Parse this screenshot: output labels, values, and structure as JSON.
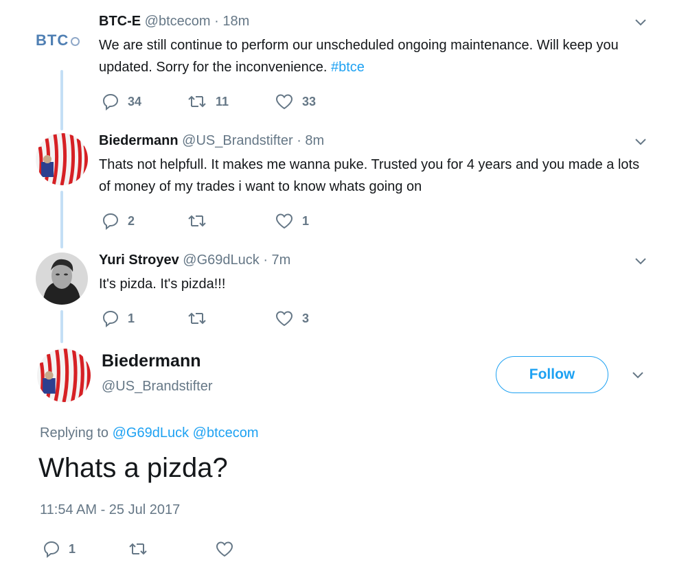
{
  "tweets": [
    {
      "name": "BTC-E",
      "handle": "@btcecom",
      "time": "· 18m",
      "avatar_text": "BTC",
      "text": "We are still continue to perform our unscheduled ongoing maintenance.  Will keep you updated. Sorry for the inconvenience.",
      "hashtag": "#btce",
      "replies": "34",
      "retweets": "11",
      "likes": "33"
    },
    {
      "name": "Biedermann",
      "handle": "@US_Brandstifter",
      "time": "· 8m",
      "text": "Thats not helpfull. It makes me wanna puke. Trusted you for 4 years and you made a lots of money of my trades i want to know whats going on",
      "replies": "2",
      "retweets": "",
      "likes": "1"
    },
    {
      "name": "Yuri Stroyev",
      "handle": "@G69dLuck",
      "time": "· 7m",
      "text": "It's pizda. It's pizda!!!",
      "replies": "1",
      "retweets": "",
      "likes": "3"
    }
  ],
  "main": {
    "name": "Biedermann",
    "handle": "@US_Brandstifter",
    "follow_label": "Follow",
    "replying_prefix": "Replying to",
    "replying_to": [
      "@G69dLuck",
      "@btcecom"
    ],
    "text": "Whats a pizda?",
    "timestamp": "11:54 AM - 25 Jul 2017",
    "replies": "1"
  },
  "colors": {
    "accent": "#1da1f2",
    "muted": "#657786",
    "thread_line": "#c4dff5"
  },
  "icons": [
    "reply-icon",
    "retweet-icon",
    "like-icon",
    "chevron-down-icon"
  ]
}
